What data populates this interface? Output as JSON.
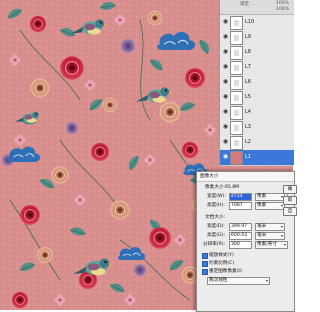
{
  "layers_panel": {
    "toolbar_fragment": "锁定 …",
    "fill_fragment": "100%",
    "layers": [
      {
        "name": "L10",
        "visible": true,
        "selected": false,
        "thumb": "white"
      },
      {
        "name": "L9",
        "visible": true,
        "selected": false,
        "thumb": "white"
      },
      {
        "name": "L8",
        "visible": true,
        "selected": false,
        "thumb": "white"
      },
      {
        "name": "L7",
        "visible": true,
        "selected": false,
        "thumb": "white"
      },
      {
        "name": "L6",
        "visible": true,
        "selected": false,
        "thumb": "white"
      },
      {
        "name": "L5",
        "visible": true,
        "selected": false,
        "thumb": "white"
      },
      {
        "name": "L4",
        "visible": true,
        "selected": false,
        "thumb": "white"
      },
      {
        "name": "L3",
        "visible": true,
        "selected": false,
        "thumb": "white"
      },
      {
        "name": "L2",
        "visible": true,
        "selected": false,
        "thumb": "white"
      },
      {
        "name": "L1",
        "visible": true,
        "selected": true,
        "thumb": "pink"
      }
    ]
  },
  "image_size_dialog": {
    "title": "图像大小",
    "pixel_dimensions_label": "像素大小:95.8M",
    "width_label": "宽度(W):",
    "width_value": "4724",
    "width_unit": "像素",
    "height_label": "高度(H):",
    "height_value": "7087",
    "height_unit": "像素",
    "document_size_label": "文档大小:",
    "doc_width_label": "宽度(D):",
    "doc_width_value": "399.97",
    "doc_width_unit": "毫米",
    "doc_height_label": "高度(G):",
    "doc_height_value": "600.03",
    "doc_height_unit": "毫米",
    "resolution_label": "分辨率(R):",
    "resolution_value": "300",
    "resolution_unit": "像素/英寸",
    "scale_styles": "缩放样式(Y)",
    "constrain_proportions": "约束比例(C)",
    "resample_image": "重定图像像素(I):",
    "resample_method": "两次线性",
    "ok_fragment": "确",
    "cancel_fragment": "取",
    "auto_fragment": "自"
  },
  "colors": {
    "pattern_background": "#d88f8d",
    "selected_layer": "#3b78d8"
  }
}
